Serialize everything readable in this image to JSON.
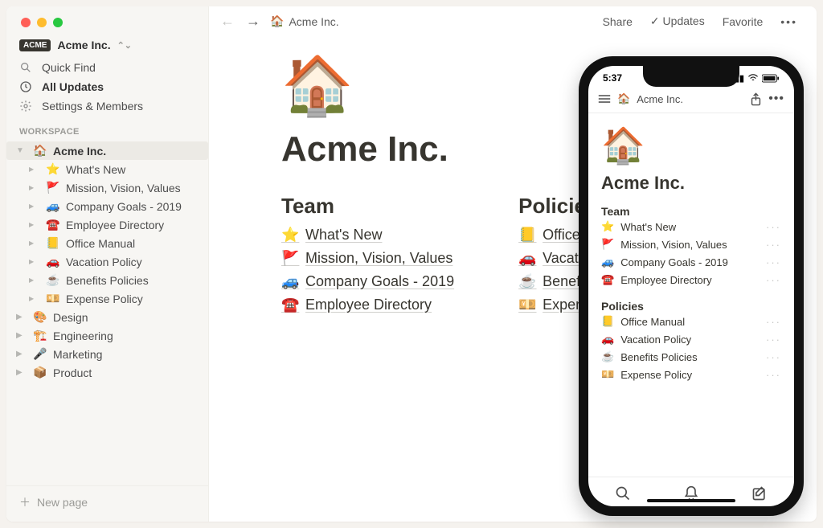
{
  "workspace_name": "Acme Inc.",
  "sidebar": {
    "quick_find": "Quick Find",
    "all_updates": "All Updates",
    "settings_members": "Settings & Members",
    "section_label": "WORKSPACE",
    "root": {
      "emoji": "🏠",
      "label": "Acme Inc."
    },
    "children": [
      {
        "emoji": "⭐",
        "label": "What's New"
      },
      {
        "emoji": "🚩",
        "label": "Mission, Vision, Values"
      },
      {
        "emoji": "🚙",
        "label": "Company Goals - 2019"
      },
      {
        "emoji": "☎️",
        "label": "Employee Directory"
      },
      {
        "emoji": "📒",
        "label": "Office Manual"
      },
      {
        "emoji": "🚗",
        "label": "Vacation Policy"
      },
      {
        "emoji": "☕",
        "label": "Benefits Policies"
      },
      {
        "emoji": "💴",
        "label": "Expense Policy"
      }
    ],
    "siblings": [
      {
        "emoji": "🎨",
        "label": "Design"
      },
      {
        "emoji": "🏗️",
        "label": "Engineering"
      },
      {
        "emoji": "🎤",
        "label": "Marketing"
      },
      {
        "emoji": "📦",
        "label": "Product"
      }
    ],
    "new_page": "New page"
  },
  "topbar": {
    "crumb_emoji": "🏠",
    "crumb_label": "Acme Inc.",
    "share": "Share",
    "updates": "Updates",
    "favorite": "Favorite"
  },
  "page": {
    "icon": "🏠",
    "title": "Acme Inc.",
    "columns": [
      {
        "heading": "Team",
        "links": [
          {
            "emoji": "⭐",
            "label": "What's New"
          },
          {
            "emoji": "🚩",
            "label": "Mission, Vision, Values"
          },
          {
            "emoji": "🚙",
            "label": "Company Goals - 2019"
          },
          {
            "emoji": "☎️",
            "label": "Employee Directory"
          }
        ]
      },
      {
        "heading": "Policies",
        "links": [
          {
            "emoji": "📒",
            "label": "Office Manual"
          },
          {
            "emoji": "🚗",
            "label": "Vacation Policy"
          },
          {
            "emoji": "☕",
            "label": "Benefits Policies"
          },
          {
            "emoji": "💴",
            "label": "Expense Policy"
          }
        ]
      }
    ]
  },
  "phone": {
    "time": "5:37",
    "header_emoji": "🏠",
    "header_label": "Acme Inc.",
    "page_icon": "🏠",
    "page_title": "Acme Inc.",
    "sections": [
      {
        "heading": "Team",
        "links": [
          {
            "emoji": "⭐",
            "label": "What's New"
          },
          {
            "emoji": "🚩",
            "label": "Mission, Vision, Values"
          },
          {
            "emoji": "🚙",
            "label": "Company Goals - 2019"
          },
          {
            "emoji": "☎️",
            "label": "Employee Directory"
          }
        ]
      },
      {
        "heading": "Policies",
        "links": [
          {
            "emoji": "📒",
            "label": "Office Manual"
          },
          {
            "emoji": "🚗",
            "label": "Vacation Policy"
          },
          {
            "emoji": "☕",
            "label": "Benefits Policies"
          },
          {
            "emoji": "💴",
            "label": "Expense Policy"
          }
        ]
      }
    ]
  }
}
